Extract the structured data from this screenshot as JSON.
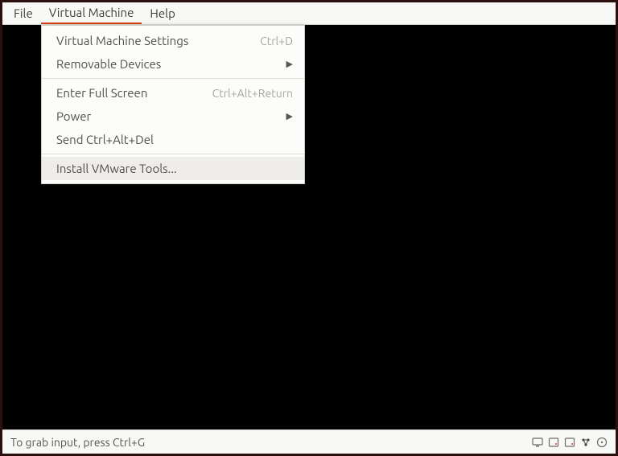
{
  "menubar": {
    "items": [
      {
        "label": "File",
        "active": false
      },
      {
        "label": "Virtual Machine",
        "active": true
      },
      {
        "label": "Help",
        "active": false
      }
    ]
  },
  "dropdown": {
    "items": [
      {
        "label": "Virtual Machine Settings",
        "shortcut": "Ctrl+D",
        "submenu": false
      },
      {
        "label": "Removable Devices",
        "shortcut": "",
        "submenu": true
      },
      {
        "sep": true
      },
      {
        "label": "Enter Full Screen",
        "shortcut": "Ctrl+Alt+Return",
        "submenu": false
      },
      {
        "label": "Power",
        "shortcut": "",
        "submenu": true
      },
      {
        "label": "Send Ctrl+Alt+Del",
        "shortcut": "",
        "submenu": false
      },
      {
        "sep": true
      },
      {
        "label": "Install VMware Tools...",
        "shortcut": "",
        "submenu": false,
        "hover": true
      }
    ]
  },
  "statusbar": {
    "hint": "To grab input, press Ctrl+G"
  },
  "icons": {
    "monitor": "monitor-icon",
    "hdd1": "disk-icon",
    "hdd2": "disk-icon",
    "network": "network-icon",
    "cd": "cd-icon"
  }
}
